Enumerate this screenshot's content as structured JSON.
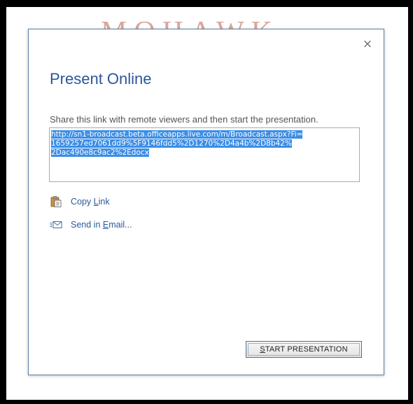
{
  "background": {
    "watermark_text": "MOHAWK"
  },
  "dialog": {
    "close_glyph": "×",
    "title": "Present Online",
    "description": "Share this link with remote viewers and then start the presentation.",
    "link_lines": [
      "http://sn1-broadcast.beta.officeapps.live.com/m/Broadcast.aspx?Fi=",
      "1659257ed7061dd9%5F9146fdd5%2D1270%2D4a4b%2D8b42%",
      "2Dac490e8c9ac2%2Edocx"
    ],
    "actions": {
      "copy_link": {
        "prefix": "Copy ",
        "underlined": "L",
        "suffix": "ink",
        "icon": "clipboard-icon"
      },
      "send_email": {
        "prefix": "Send in ",
        "underlined": "E",
        "suffix": "mail...",
        "icon": "email-icon"
      }
    },
    "start_button": {
      "underlined": "S",
      "rest": "TART PRESENTATION"
    }
  },
  "colors": {
    "title": "#2b579a",
    "link_highlight": "#3c8ee6",
    "dialog_border": "#5b80a8"
  }
}
